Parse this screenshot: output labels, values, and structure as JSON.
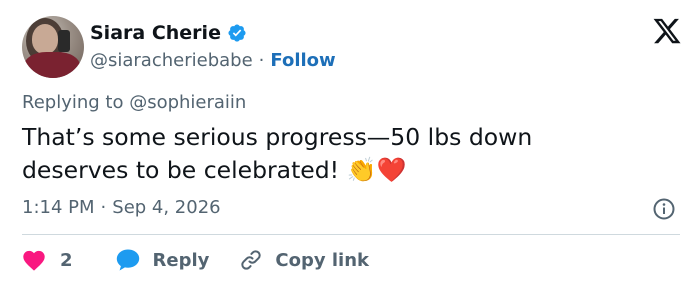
{
  "author": {
    "name": "Siara Cherie",
    "handle": "@siaracheriebabe",
    "separator": "·",
    "follow_label": "Follow"
  },
  "tweet": {
    "replying_to": "Replying to @sophieraiin",
    "text_line1": "That’s some serious progress—50 lbs down",
    "text_line2": "deserves to be celebrated!",
    "emojis": "👏❤️",
    "time": "1:14 PM",
    "date": "Sep 4, 2026"
  },
  "actions": {
    "like_count": "2",
    "reply_label": "Reply",
    "copy_label": "Copy link"
  },
  "colors": {
    "like": "#f91880",
    "reply": "#1d9bf0",
    "follow": "#1d6fb8",
    "verified": "#1d9bf0",
    "muted": "#536471"
  },
  "icons": [
    "verified-badge-icon",
    "x-logo-icon",
    "info-icon",
    "heart-icon",
    "speech-bubble-icon",
    "link-icon"
  ]
}
